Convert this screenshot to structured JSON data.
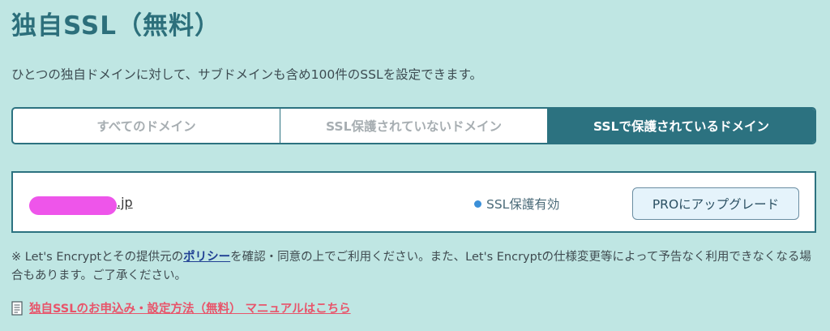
{
  "header": {
    "title": "独自SSL（無料）",
    "description": "ひとつの独自ドメインに対して、サブドメインも含め100件のSSLを設定できます。"
  },
  "tabs": [
    {
      "label": "すべてのドメイン",
      "active": false
    },
    {
      "label": "SSL保護されていないドメイン",
      "active": false
    },
    {
      "label": "SSLで保護されているドメイン",
      "active": true
    }
  ],
  "domain_row": {
    "domain_suffix": ".jp",
    "status": "SSL保護有効",
    "status_color": "#3b8fd8",
    "upgrade_label": "PROにアップグレード",
    "redaction_color": "#ee55ea"
  },
  "notice": {
    "prefix": "※ Let's Encryptとその提供元の",
    "policy_link": "ポリシー",
    "suffix": "を確認・同意の上でご利用ください。また、Let's Encryptの仕様変更等によって予告なく利用できなくなる場合もあります。ご了承ください。"
  },
  "manual": {
    "icon": "document-icon",
    "link_text": "独自SSLのお申込み・設定方法（無料） マニュアルはこちら"
  },
  "colors": {
    "background": "#bfe6e3",
    "accent": "#2c7280",
    "title": "#2c6f7b",
    "manual_link": "#e8546a"
  }
}
